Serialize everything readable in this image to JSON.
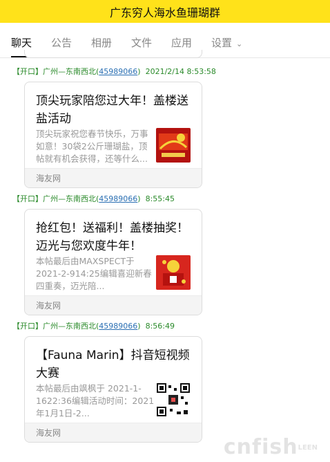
{
  "header": {
    "title": "广东穷人海水鱼珊瑚群"
  },
  "tabs": [
    {
      "label": "聊天"
    },
    {
      "label": "公告"
    },
    {
      "label": "相册"
    },
    {
      "label": "文件"
    },
    {
      "label": "应用"
    },
    {
      "label": "设置"
    }
  ],
  "messages": [
    {
      "tag": "【开口】",
      "sender": "广州—东南西北",
      "open_paren": "(",
      "qq": "45989066",
      "close_paren": ")",
      "time": "2021/2/14 8:53:58",
      "card": {
        "title": "顶尖玩家陪您过大年！盖楼送盐活动",
        "desc": "顶尖玩家祝您春节快乐，万事如意！30袋2公斤珊瑚盐，顶帖就有机会获得，还等什么...",
        "thumb": "red-new-year-icon",
        "source": "海友网"
      }
    },
    {
      "tag": "【开口】",
      "sender": "广州—东南西北",
      "open_paren": "(",
      "qq": "45989066",
      "close_paren": ")",
      "time": "8:55:45",
      "card": {
        "title": "抢红包！送福利！盖楼抽奖！迈光与您欢度牛年！",
        "desc": "本帖最后由MAXSPECT于 2021-2-914:25编辑喜迎新春四重奏，迈光陪...",
        "thumb": "red-envelope-icon",
        "source": "海友网"
      }
    },
    {
      "tag": "【开口】",
      "sender": "广州—东南西北",
      "open_paren": "(",
      "qq": "45989066",
      "close_paren": ")",
      "time": "8:56:49",
      "card": {
        "title": "【Fauna Marin】抖音短视频大赛",
        "desc": "本帖最后由飒枫于 2021-1-1622:36编辑活动时间：2021年1月1日-2...",
        "thumb": "qr-code-icon",
        "source": "海友网"
      }
    }
  ],
  "watermark": {
    "brand": "cnfish",
    "suffix": "LEEN"
  },
  "colors": {
    "header_bg": "#ffe21a",
    "meta_green": "#2a8a2a",
    "link_blue": "#2a6fb3"
  }
}
